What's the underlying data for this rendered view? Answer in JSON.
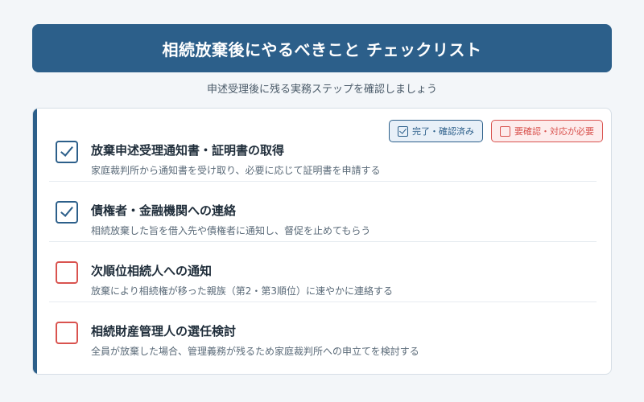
{
  "header": {
    "title": "相続放棄後にやるべきこと チェックリスト"
  },
  "subtitle": "申述受理後に残る実務ステップを確認しましょう",
  "legend": {
    "done_label": "完了・確認済み",
    "todo_label": "要確認・対応が必要"
  },
  "colors": {
    "accent": "#2c5f8a",
    "alert": "#d9534f",
    "background": "#f3f6f9"
  },
  "items": [
    {
      "title": "放棄申述受理通知書・証明書の取得",
      "description": "家庭裁判所から通知書を受け取り、必要に応じて証明書を申請する",
      "status": "done"
    },
    {
      "title": "債権者・金融機関への連絡",
      "description": "相続放棄した旨を借入先や債権者に通知し、督促を止めてもらう",
      "status": "done"
    },
    {
      "title": "次順位相続人への通知",
      "description": "放棄により相続権が移った親族（第2・第3順位）に速やかに連絡する",
      "status": "todo"
    },
    {
      "title": "相続財産管理人の選任検討",
      "description": "全員が放棄した場合、管理義務が残るため家庭裁判所への申立てを検討する",
      "status": "todo"
    }
  ]
}
